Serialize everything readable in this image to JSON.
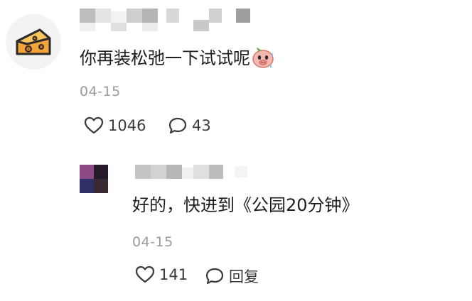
{
  "comment": {
    "username_redacted": true,
    "avatar_icon": "cheese-icon",
    "text": "你再装松弛一下试试呢",
    "emoji_icon": "sweating-pig-emoji-icon",
    "date": "04-15",
    "likes": "1046",
    "replies": "43",
    "like_icon": "heart-outline-icon",
    "reply_icon": "chat-bubble-icon"
  },
  "reply": {
    "username_redacted": true,
    "text": "好的，快进到《公园20分钟》",
    "date": "04-15",
    "likes": "141",
    "reply_label": "回复",
    "like_icon": "heart-outline-icon",
    "reply_icon": "chat-bubble-icon"
  },
  "colors": {
    "text": "#1e1e1e",
    "secondary": "#9a9a9a",
    "avatar_bg": "#f3f3f3",
    "cheese": "#f2a33a"
  }
}
